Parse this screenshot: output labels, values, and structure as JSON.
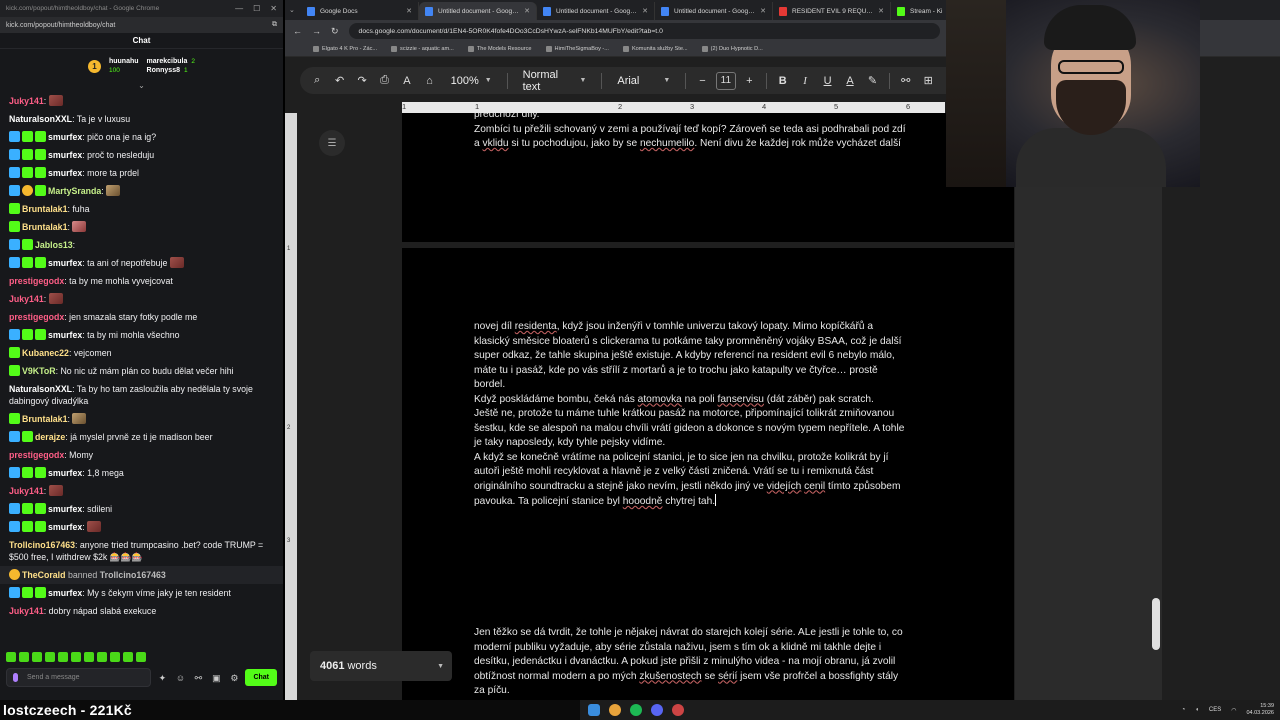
{
  "chat_window": {
    "title": "kick.com/popout/himtheoldboy/chat - Google Chrome",
    "url": "kick.com/popout/himtheoldboy/chat",
    "header": "Chat",
    "pinned": [
      {
        "name": "huunahu",
        "count": "100"
      },
      {
        "name": "marekcibula",
        "count": "2"
      },
      {
        "name": "Ronnyss8",
        "count": "1"
      }
    ],
    "pinned_badge": "1",
    "messages": [
      {
        "user": "Juky141",
        "color": "#ff5e87",
        "badges": [],
        "text": "",
        "emote": "e1"
      },
      {
        "user": "NaturalsonXXL",
        "color": "#ffffff",
        "badges": [],
        "text": "Ta je v luxusu"
      },
      {
        "user": "smurfex",
        "color": "#ffffff",
        "badges": [
          "mod",
          "sub",
          "sub"
        ],
        "text": "pičo ona je na ig?"
      },
      {
        "user": "smurfex",
        "color": "#ffffff",
        "badges": [
          "mod",
          "sub",
          "sub"
        ],
        "text": "proč to nesleduju"
      },
      {
        "user": "smurfex",
        "color": "#ffffff",
        "badges": [
          "mod",
          "sub",
          "sub"
        ],
        "text": "more ta prdel"
      },
      {
        "user": "MartySranda",
        "color": "#c6f08a",
        "badges": [
          "mod",
          "vip",
          "sub"
        ],
        "text": "",
        "emote": "e3"
      },
      {
        "user": "Bruntalak1",
        "color": "#ffe08a",
        "badges": [
          "sub"
        ],
        "text": "fuha"
      },
      {
        "user": "Bruntalak1",
        "color": "#ffe08a",
        "badges": [
          "sub"
        ],
        "text": "",
        "emote": "e2"
      },
      {
        "user": "Jablos13",
        "color": "#c6f08a",
        "badges": [
          "mod",
          "sub"
        ],
        "text": "",
        "emote": ""
      },
      {
        "user": "smurfex",
        "color": "#ffffff",
        "badges": [
          "mod",
          "sub",
          "sub"
        ],
        "text": "ta ani of nepotřebuje",
        "emote": "e1"
      },
      {
        "user": "prestigegodx",
        "color": "#ff5e87",
        "badges": [],
        "text": "ta by me mohla vyvejcovat"
      },
      {
        "user": "Juky141",
        "color": "#ff5e87",
        "badges": [],
        "text": "",
        "emote": "e1"
      },
      {
        "user": "prestigegodx",
        "color": "#ff5e87",
        "badges": [],
        "text": "jen smazala stary fotky podle me"
      },
      {
        "user": "smurfex",
        "color": "#ffffff",
        "badges": [
          "mod",
          "sub",
          "sub"
        ],
        "text": "ta by mi mohla všechno"
      },
      {
        "user": "Kubanec22",
        "color": "#ffe08a",
        "badges": [
          "sub"
        ],
        "text": "vejcomen"
      },
      {
        "user": "V9KToR",
        "color": "#c6f08a",
        "badges": [
          "sub"
        ],
        "text": "No nic už mám plán co budu dělat večer hihi"
      },
      {
        "user": "NaturalsonXXL",
        "color": "#ffffff",
        "badges": [],
        "text": "Ta by ho tam zasloužila aby nedělala ty svoje dabingový divadýlka"
      },
      {
        "user": "Bruntalak1",
        "color": "#ffe08a",
        "badges": [
          "sub"
        ],
        "text": "",
        "emote": "e3"
      },
      {
        "user": "derajze",
        "color": "#ffe08a",
        "badges": [
          "mod",
          "sub"
        ],
        "text": "já myslel prvně ze ti je madison beer"
      },
      {
        "user": "prestigegodx",
        "color": "#ff5e87",
        "badges": [],
        "text": "Momy"
      },
      {
        "user": "smurfex",
        "color": "#ffffff",
        "badges": [
          "mod",
          "sub",
          "sub"
        ],
        "text": "1,8 mega"
      },
      {
        "user": "Juky141",
        "color": "#ff5e87",
        "badges": [],
        "text": "",
        "emote": "e1"
      },
      {
        "user": "smurfex",
        "color": "#ffffff",
        "badges": [
          "mod",
          "sub",
          "sub"
        ],
        "text": "sdileni"
      },
      {
        "user": "smurfex",
        "color": "#ffffff",
        "badges": [
          "mod",
          "sub",
          "sub"
        ],
        "text": "",
        "emote": "e1"
      },
      {
        "user": "Trollcino167463",
        "color": "#ffe08a",
        "badges": [],
        "text": "anyone tried trumpcasino .bet? code TRUMP = $500 free, I withdrew $2k 🎰🎰🎰"
      }
    ],
    "ban_notice": {
      "actor": "TheCorald",
      "verb": "banned",
      "target": "Trollcino167463"
    },
    "after_ban": [
      {
        "user": "smurfex",
        "color": "#ffffff",
        "badges": [
          "mod",
          "sub",
          "sub"
        ],
        "text": "My s čekym víme jaky je ten resident"
      },
      {
        "user": "Juky141",
        "color": "#ff5e87",
        "badges": [],
        "text": "dobry nápad slabá exekuce"
      }
    ],
    "input_placeholder": "Send a message",
    "send_label": "Chat"
  },
  "overlay": {
    "text": "lostczeech - 221Kč"
  },
  "browser": {
    "tabs": [
      {
        "label": "Google Docs",
        "active": false,
        "fav": "blue"
      },
      {
        "label": "Untitled document - Google Do",
        "active": true,
        "fav": "blue"
      },
      {
        "label": "Untitled document - Google Do",
        "active": false,
        "fav": "blue"
      },
      {
        "label": "Untitled document - Google Do",
        "active": false,
        "fav": "blue"
      },
      {
        "label": "RESIDENT EVIL 9 REQUIEM Ga",
        "active": false,
        "fav": "red"
      },
      {
        "label": "Stream - Ki",
        "active": false,
        "fav": "green"
      }
    ],
    "url": "docs.google.com/document/d/1EN4-5OR0K4fofe4DOo3CcDsHYwzA-selFNKb14MUFbY/edit?tab=t.0",
    "bookmarks": [
      "Elgato 4 K Pro - Zác...",
      "scizzie - aquatic am...",
      "The Models Resource",
      "HimiTheSigmaBoy -...",
      "Komunita služby Ste...",
      "(2) Duo Hypnotic D..."
    ]
  },
  "docs": {
    "zoom": "100%",
    "style": "Normal text",
    "font": "Arial",
    "font_size": "11",
    "ruler_numbers": [
      "1",
      "1",
      "2",
      "3",
      "4",
      "5",
      "6"
    ],
    "vruler_numbers": [
      "1",
      "2",
      "3"
    ],
    "page1_lines": [
      "předchozí díly.",
      "Zombíci tu přežili schovaný v zemi a používají teď kopí? Zároveň se teda asi podhrabali pod zdí",
      "a vklidu si tu pochodujou, jako by se nechumelilo. Není divu že každej rok může vycházet další"
    ],
    "page2_p1": [
      "novej díl residenta, když jsou inženýři v tomhle univerzu takový lopaty. Mimo kopíčkářů a",
      "klasický směsice bloaterů s clickerama tu potkáme taky promněněný vojáky BSAA, což je další",
      "super odkaz, že tahle skupina ještě existuje. A kdyby referencí na resident evil 6 nebylo málo,",
      "máte tu i pasáž, kde po vás střílí z mortarů a je to trochu jako katapulty ve čtyřce… prostě",
      "bordel.",
      "Když poskládáme bombu, čeká nás atomovka na poli fanservisu (dát záběr) pak scratch.",
      "Ještě ne, protože tu máme  tuhle krátkou pasáž na motorce, připomínající tolikrát zmiňovanou",
      "šestku, kde se alespoň na malou chvíli vrátí gideon a dokonce s novým typem nepřítele. A tohle",
      "je taky naposledy, kdy tyhle pejsky vidíme.",
      "A když se konečně vrátíme na policejní stanici, je to sice jen na chvilku, protože kolikrát by jí",
      "autoři ještě mohli recyklovat a hlavně je z velký části zničená. Vrátí se tu i remixnutá část",
      "originálního soundtracku a stejně jako nevím, jestli někdo jiný ve videjích cenil tímto způsobem",
      "pavouka. Ta policejní stanice byl hooodně chytrej tah."
    ],
    "page2_p2": [
      "Jen těžko se dá tvrdit, že tohle je nějakej návrat do starejch kolejí série. ALe jestli je tohle to, co",
      "moderní publiku vyžaduje, aby série zůstala naživu, jsem s tím ok a klidně mi takhle dejte i",
      "desítku, jedenáctku i dvanáctku. A pokud jste přišli z minulýho videa - na mojí obranu, já zvolil",
      "obtížnost normal modern a po mých zkušenostech se sérií jsem vše profrčel a bossfighty stály",
      "za píču."
    ],
    "word_count": "4061",
    "word_label": "words"
  },
  "taskbar": {
    "lang": "CES",
    "time": "15:39",
    "date": "04.03.2026"
  }
}
